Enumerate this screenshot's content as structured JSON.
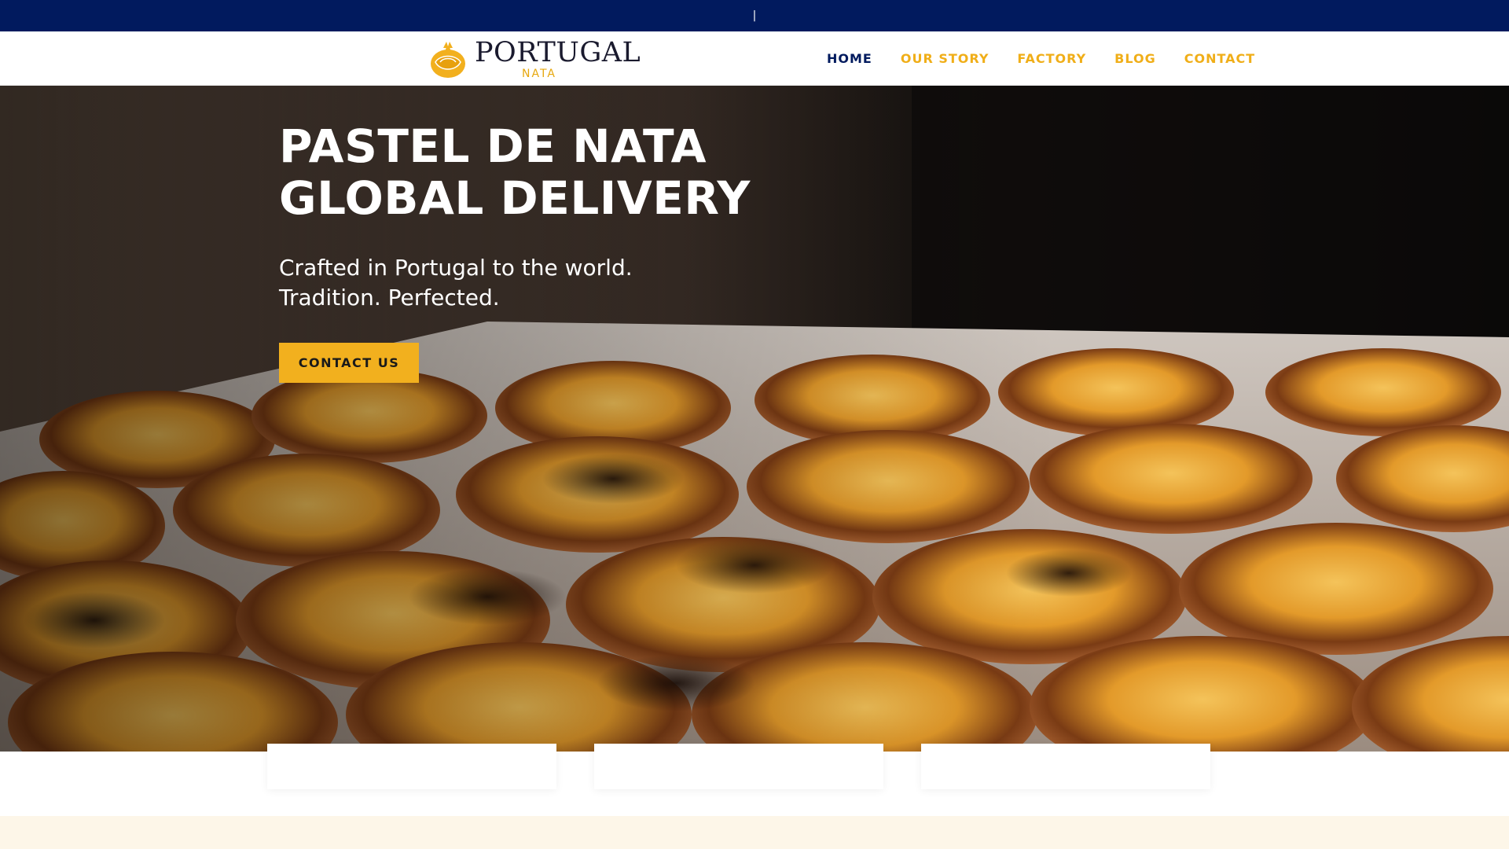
{
  "topbar": {
    "text": "|"
  },
  "brand": {
    "name": "PORTUGAL",
    "sub": "NATA"
  },
  "nav": {
    "items": [
      {
        "label": "HOME",
        "active": true
      },
      {
        "label": "OUR STORY",
        "active": false
      },
      {
        "label": "FACTORY",
        "active": false
      },
      {
        "label": "BLOG",
        "active": false
      },
      {
        "label": "CONTACT",
        "active": false
      }
    ]
  },
  "hero": {
    "title_line1": "PASTEL DE NATA",
    "title_line2": "GLOBAL DELIVERY",
    "subtitle_line1": "Crafted in Portugal to the world.",
    "subtitle_line2": "Tradition. Perfected.",
    "cta_label": "CONTACT US",
    "background_icon": "pastel-de-nata-photo"
  },
  "colors": {
    "topbar_bg": "#011a5e",
    "accent": "#f2b01e",
    "nav_active": "#011a5e",
    "nav_default": "#f0ae18",
    "footer_strip": "#fdf6e8"
  }
}
